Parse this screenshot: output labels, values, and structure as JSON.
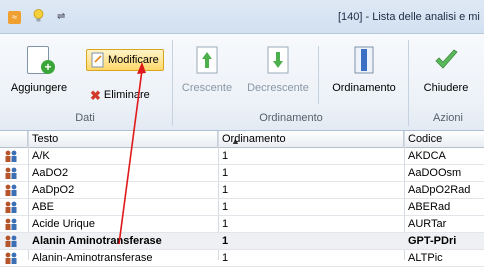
{
  "window": {
    "title": "[140] - Lista delle analisi e mi",
    "quick_access": "⇌"
  },
  "ribbon": {
    "groups": {
      "dati": "Dati",
      "ordinamento": "Ordinamento",
      "azioni": "Azioni"
    },
    "buttons": {
      "aggiungere": "Aggiungere",
      "modificare": "Modificare",
      "eliminare": "Eliminare",
      "crescente": "Crescente",
      "decrescente": "Decrescente",
      "ordinamento": "Ordinamento",
      "chiudere": "Chiudere"
    }
  },
  "grid": {
    "headers": {
      "testo": "Testo",
      "ordinamento": "Ordinamento",
      "codice": "Codice"
    },
    "rows": [
      {
        "testo": "A/K",
        "ordinamento": "1",
        "codice": "AKDCA"
      },
      {
        "testo": "AaDO2",
        "ordinamento": "1",
        "codice": "AaDOOsm"
      },
      {
        "testo": "AaDpO2",
        "ordinamento": "1",
        "codice": "AaDpO2Rad"
      },
      {
        "testo": "ABE",
        "ordinamento": "1",
        "codice": "ABERad"
      },
      {
        "testo": "Acide Urique",
        "ordinamento": "1",
        "codice": "AURTar"
      },
      {
        "testo": "Alanin Aminotransferase",
        "ordinamento": "1",
        "codice": "GPT-PDri"
      },
      {
        "testo": "Alanin-Aminotransferase",
        "ordinamento": "1",
        "codice": "ALTPic"
      }
    ]
  },
  "colors": {
    "accent_arrow": "#e0191a",
    "selected_button": "#ffd86a",
    "add_green": "#3aa63a"
  }
}
